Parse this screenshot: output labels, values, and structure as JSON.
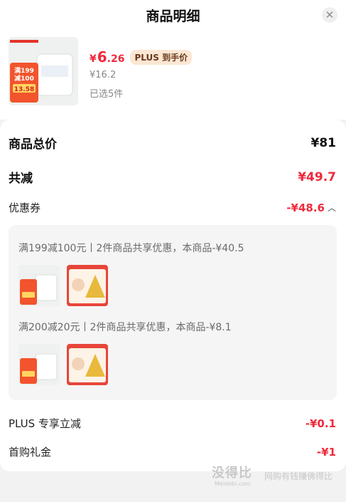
{
  "header": {
    "title": "商品明细"
  },
  "product": {
    "badge_line1": "满199",
    "badge_line2": "减100",
    "badge_price": "13.58",
    "price_yen": "¥",
    "price_int": "6",
    "price_dec": ".26",
    "plus_tag": "PLUS 到手价",
    "orig_price": "¥16.2",
    "selected": "已选5件"
  },
  "summary": {
    "total_label": "商品总价",
    "total_value": "¥81",
    "reduce_label": "共减",
    "reduce_value": "¥49.7",
    "coupon_label": "优惠券",
    "coupon_value": "-¥48.6"
  },
  "coupons": [
    {
      "text": "满199减100元丨2件商品共享优惠，本商品-¥40.5"
    },
    {
      "text": "满200减20元丨2件商品共享优惠，本商品-¥8.1"
    }
  ],
  "extras": {
    "plus_label": "PLUS 专享立减",
    "plus_value": "-¥0.1",
    "first_label": "首购礼金",
    "first_value": "-¥1"
  },
  "watermark": {
    "brand": "没得比",
    "site": "Meidebi.com",
    "slogan": "网购有钱赚佛得比"
  },
  "colors": {
    "accent": "#ef2a3c",
    "plus_bg": "#fbe7d3"
  }
}
